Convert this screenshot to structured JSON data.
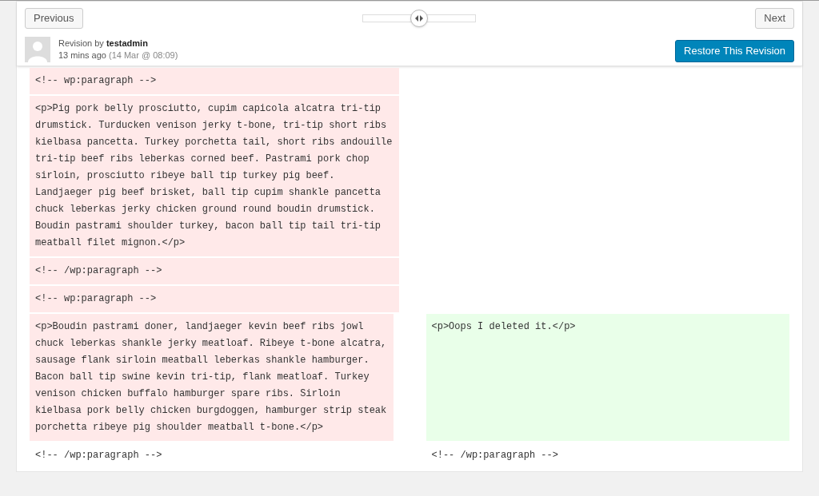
{
  "nav": {
    "previous": "Previous",
    "next": "Next"
  },
  "slider": {
    "level": 0.5
  },
  "revision": {
    "prefix": "Revision by",
    "author": "testadmin",
    "time": "13 mins ago",
    "date": "(14 Mar @ 08:09)"
  },
  "restore_button": "Restore This Revision",
  "rows": [
    {
      "left": {
        "kind": "deleted",
        "text": "<!-- wp:paragraph -->"
      },
      "right": {
        "kind": "empty"
      }
    },
    {
      "left": {
        "kind": "deleted",
        "text": "<p>Pig pork belly prosciutto, cupim capicola alcatra tri-tip drumstick. Turducken venison jerky t-bone, tri-tip short ribs kielbasa pancetta. Turkey porchetta tail, short ribs andouille tri-tip beef ribs leberkas corned beef. Pastrami pork chop sirloin, prosciutto ribeye ball tip turkey pig beef. Landjaeger pig beef brisket, ball tip cupim shankle pancetta chuck leberkas jerky chicken ground round boudin drumstick. Boudin pastrami shoulder turkey, bacon ball tip tail tri-tip meatball filet mignon.</p>"
      },
      "right": {
        "kind": "empty"
      }
    },
    {
      "left": {
        "kind": "deleted",
        "text": "<!-- /wp:paragraph -->"
      },
      "right": {
        "kind": "empty"
      }
    },
    {
      "left": {
        "kind": "deleted",
        "text": "<!-- wp:paragraph -->"
      },
      "right": {
        "kind": "empty"
      }
    },
    {
      "left": {
        "kind": "deleted",
        "text": "<p>Boudin pastrami doner, landjaeger kevin beef ribs jowl chuck leberkas shankle jerky meatloaf. Ribeye t-bone alcatra, sausage flank sirloin meatball leberkas shankle hamburger. Bacon ball tip swine kevin tri-tip, flank meatloaf. Turkey venison chicken buffalo hamburger spare ribs. Sirloin kielbasa pork belly chicken burgdoggen, hamburger strip steak porchetta ribeye pig shoulder meatball t-bone.</p>"
      },
      "right": {
        "kind": "added",
        "text": "<p>Oops I deleted it.</p>"
      }
    },
    {
      "left": {
        "kind": "context",
        "text": "<!-- /wp:paragraph -->"
      },
      "right": {
        "kind": "context",
        "text": "<!-- /wp:paragraph -->"
      }
    }
  ]
}
